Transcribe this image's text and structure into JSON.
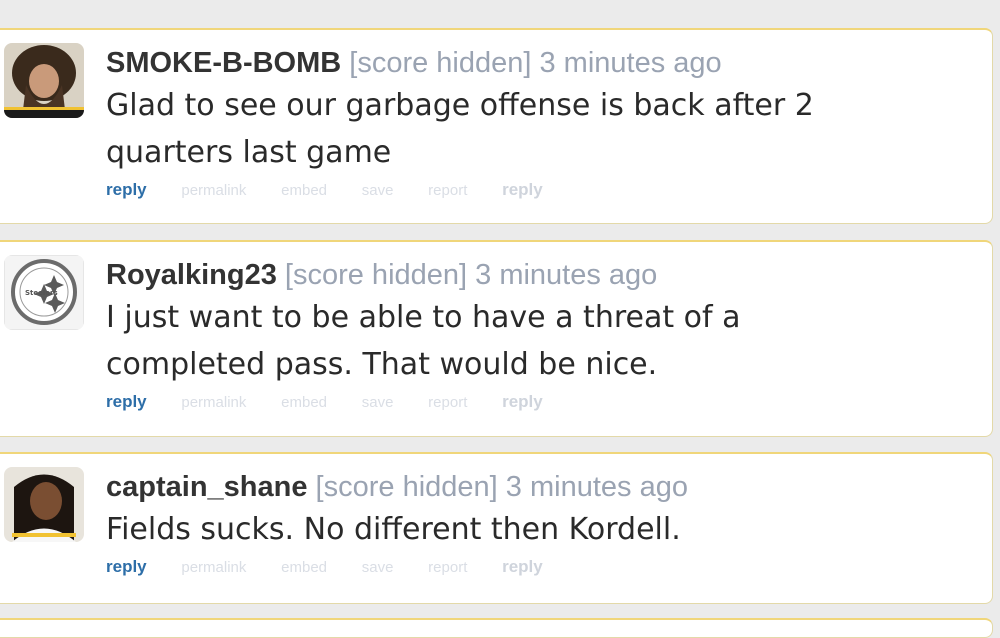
{
  "comments": [
    {
      "author": "SMOKE-B-BOMB",
      "score": "[score hidden]",
      "time": "3 minutes ago",
      "lines": [
        "Glad to see our garbage offense is back after 2",
        "quarters last game"
      ],
      "avatar": "bearded-fan-avatar"
    },
    {
      "author": "Royalking23",
      "score": "[score hidden]",
      "time": "3 minutes ago",
      "lines": [
        "I just want to be able to have a threat of a",
        "completed pass. That would be nice."
      ],
      "avatar": "steelers-logo-avatar"
    },
    {
      "author": "captain_shane",
      "score": "[score hidden]",
      "time": "3 minutes ago",
      "lines": [
        "Fields sucks. No different then Kordell."
      ],
      "avatar": "player-photo-avatar"
    }
  ],
  "actions": {
    "reply": "reply",
    "permalink": "permalink",
    "embed": "embed",
    "save": "save",
    "report": "report",
    "reply_secondary": "reply"
  },
  "colors": {
    "link": "#2d6ea8",
    "meta": "#9aa3b2",
    "border": "#f0d67a"
  }
}
